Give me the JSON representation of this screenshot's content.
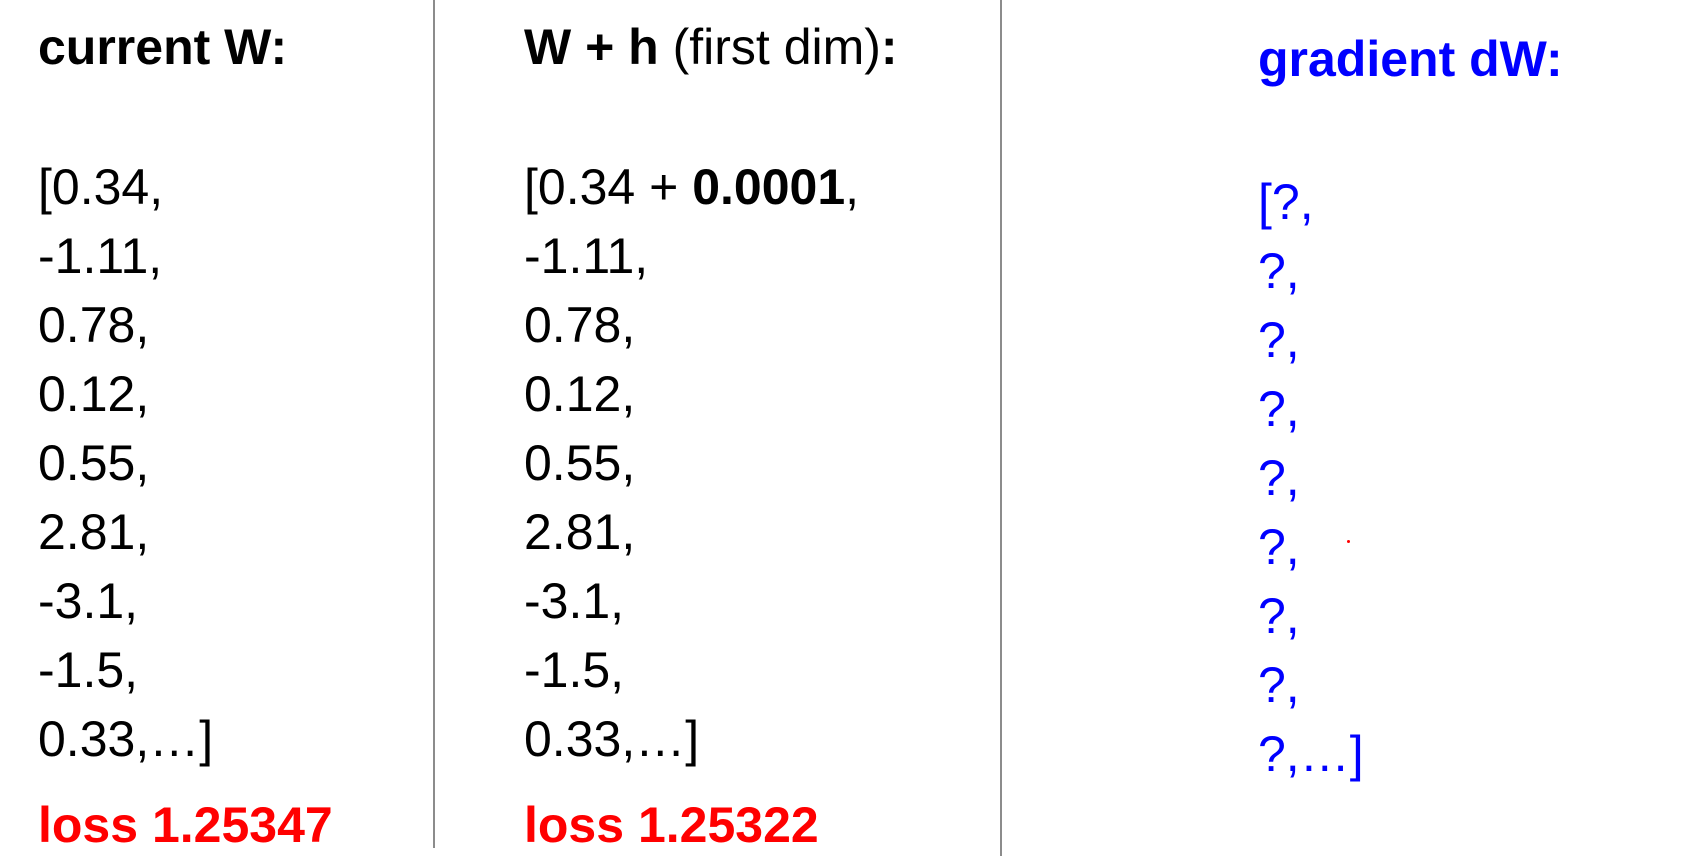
{
  "colors": {
    "text": "#000000",
    "loss": "#ff0000",
    "gradient": "#0000ff",
    "divider": "#8c8c8c"
  },
  "current": {
    "heading": "current W:",
    "values": [
      "[0.34,",
      "-1.11,",
      "0.78,",
      "0.12,",
      "0.55,",
      "2.81,",
      "-3.1,",
      "-1.5,",
      "0.33,…]"
    ],
    "loss": "loss 1.25347"
  },
  "perturbed": {
    "heading_bold": "W + h",
    "heading_normal": " (first dim)",
    "heading_colon": ":",
    "first_prefix": "[0.34 + ",
    "first_bold": "0.0001",
    "first_suffix": ",",
    "values": [
      "-1.11,",
      "0.78,",
      "0.12,",
      "0.55,",
      "2.81,",
      "-3.1,",
      "-1.5,",
      "0.33,…]"
    ],
    "loss": "loss 1.25322"
  },
  "gradient": {
    "heading": "gradient dW:",
    "values": [
      "[?,",
      "?,",
      "?,",
      "?,",
      "?,",
      "?,",
      "?,",
      "?,",
      "?,…]"
    ]
  }
}
